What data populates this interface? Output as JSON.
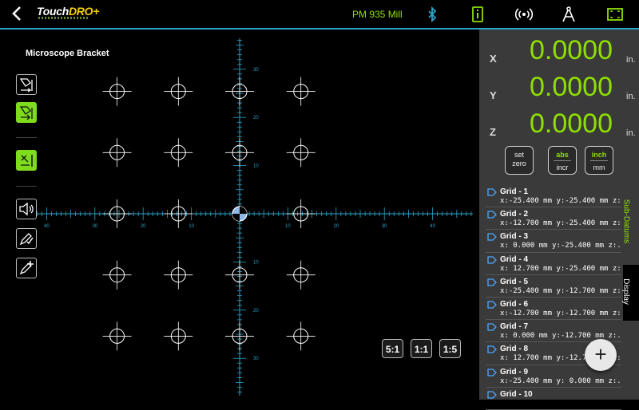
{
  "header": {
    "app_name_part1": "Touch",
    "app_name_part2": "DRO",
    "machine": "PM 935 Mill",
    "icons": [
      "back-arrow-icon",
      "bluetooth-icon",
      "info-icon",
      "broadcast-icon",
      "compass-icon",
      "fullscreen-icon"
    ]
  },
  "canvas": {
    "title": "Microscope Bracket",
    "x_tick_labels": [
      "40",
      "30",
      "20",
      "10",
      "10",
      "20",
      "30",
      "40"
    ],
    "y_tick_labels": [
      "30",
      "20",
      "10",
      "10",
      "20",
      "30"
    ],
    "grid_points": [
      [
        -25.4,
        25.4
      ],
      [
        -12.7,
        25.4
      ],
      [
        0,
        25.4
      ],
      [
        12.7,
        25.4
      ],
      [
        -25.4,
        12.7
      ],
      [
        -12.7,
        12.7
      ],
      [
        0,
        12.7
      ],
      [
        12.7,
        12.7
      ],
      [
        -25.4,
        0
      ],
      [
        -12.7,
        0
      ],
      [
        12.7,
        0
      ],
      [
        -25.4,
        -12.7
      ],
      [
        -12.7,
        -12.7
      ],
      [
        0,
        -12.7
      ],
      [
        12.7,
        -12.7
      ],
      [
        -25.4,
        -25.4
      ],
      [
        -12.7,
        -25.4
      ],
      [
        0,
        -25.4
      ],
      [
        12.7,
        -25.4
      ]
    ],
    "zoom_buttons": [
      "5:1",
      "1:1",
      "1:5"
    ]
  },
  "dro": {
    "axes": [
      {
        "name": "X",
        "value": "0.0000",
        "unit": "in."
      },
      {
        "name": "Y",
        "value": "0.0000",
        "unit": "in."
      },
      {
        "name": "Z",
        "value": "0.0000",
        "unit": "in."
      }
    ],
    "buttons": {
      "set_zero_top": "set",
      "set_zero_bottom": "zero",
      "abs_top": "abs",
      "abs_bottom": "incr",
      "inch_top": "inch",
      "inch_bottom": "mm"
    }
  },
  "subdatums": {
    "tab_label": "Sub-Datums",
    "display_tab": "Display",
    "items": [
      {
        "name": "Grid - 1",
        "coords": "x:-25.400 mm y:-25.400 mm z:..."
      },
      {
        "name": "Grid - 2",
        "coords": "x:-12.700 mm y:-25.400 mm z:..."
      },
      {
        "name": "Grid - 3",
        "coords": "x: 0.000 mm y:-25.400 mm z:..."
      },
      {
        "name": "Grid - 4",
        "coords": "x: 12.700 mm y:-25.400 mm z:..."
      },
      {
        "name": "Grid - 5",
        "coords": "x:-25.400 mm y:-12.700 mm z:..."
      },
      {
        "name": "Grid - 6",
        "coords": "x:-12.700 mm y:-12.700 mm z:..."
      },
      {
        "name": "Grid - 7",
        "coords": "x: 0.000 mm y:-12.700 mm z:..."
      },
      {
        "name": "Grid - 8",
        "coords": "x: 12.700 mm y:-12.700 mm z:..."
      },
      {
        "name": "Grid - 9",
        "coords": "x:-25.400 mm y: 0.000 mm z:..."
      },
      {
        "name": "Grid - 10",
        "coords": ""
      }
    ],
    "add_label": "+"
  },
  "colors": {
    "accent_green": "#8fe000",
    "cyan": "#2aa3c8",
    "panel": "#3a3a3a"
  }
}
